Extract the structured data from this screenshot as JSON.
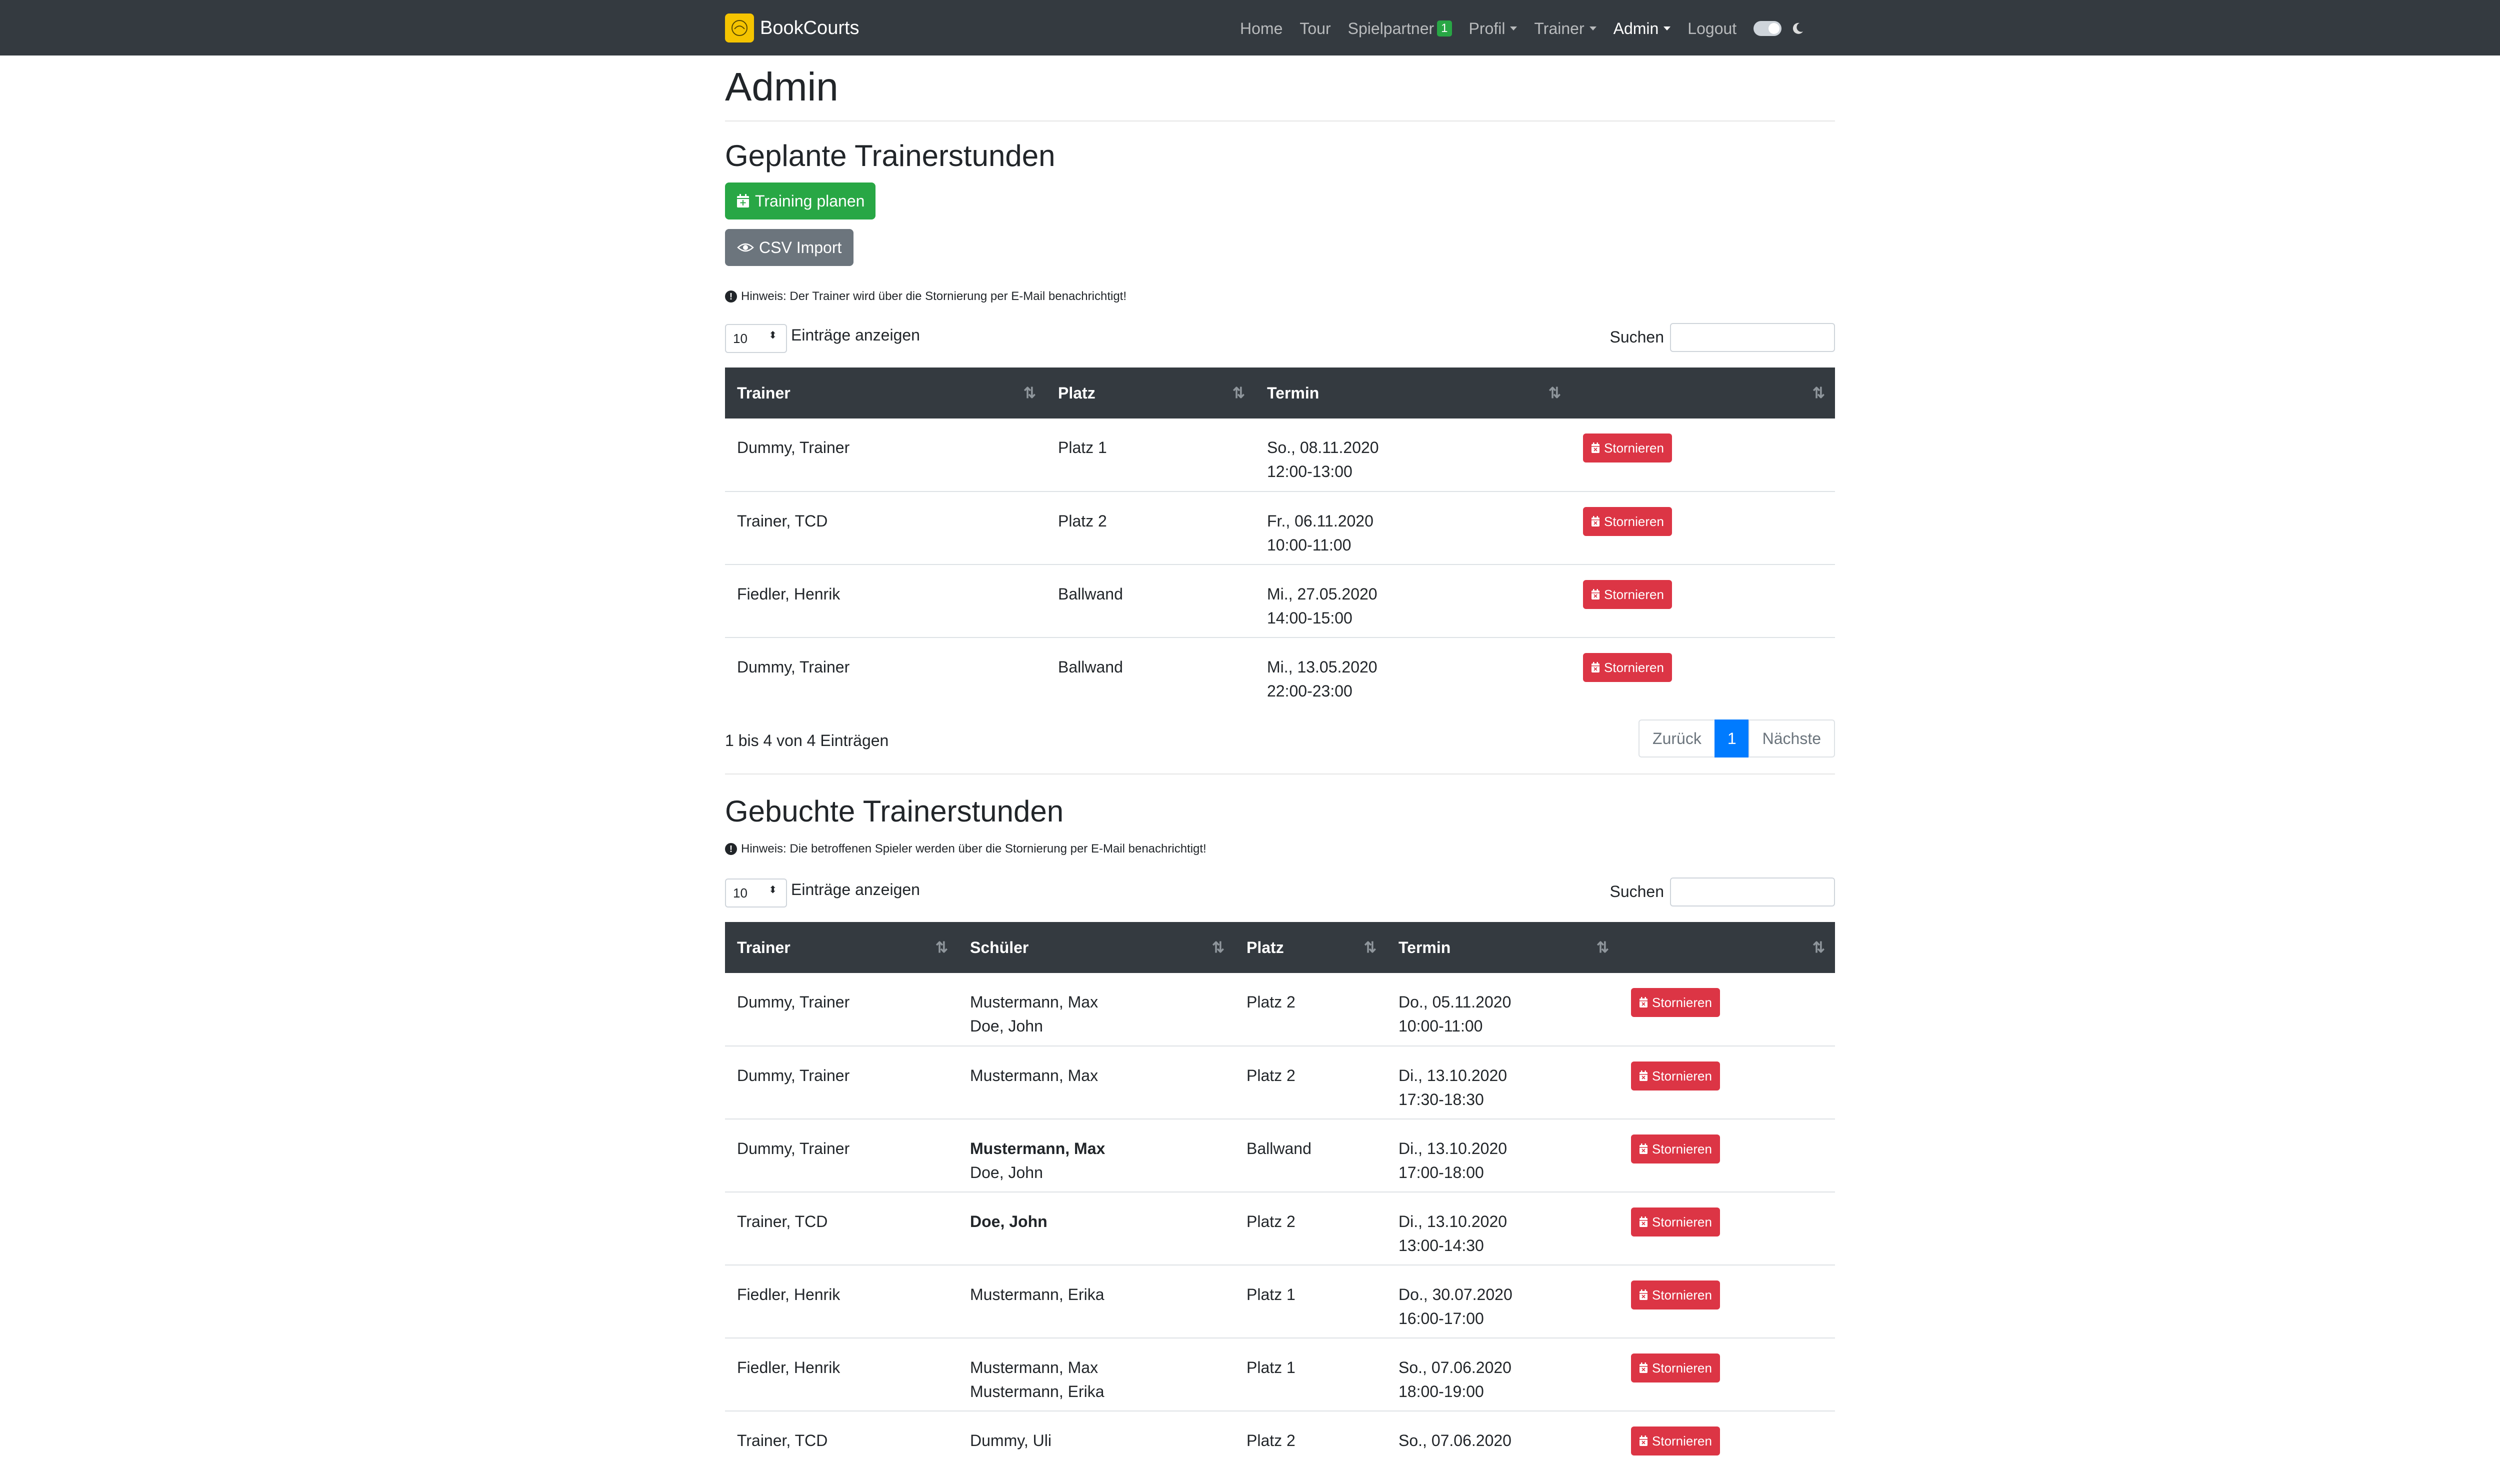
{
  "navbar": {
    "brand": "BookCourts",
    "items": [
      {
        "label": "Home"
      },
      {
        "label": "Tour"
      },
      {
        "label": "Spielpartner",
        "badge": "1"
      },
      {
        "label": "Profil"
      },
      {
        "label": "Trainer"
      },
      {
        "label": "Admin"
      },
      {
        "label": "Logout"
      }
    ]
  },
  "page": {
    "title": "Admin"
  },
  "planned": {
    "heading": "Geplante Trainerstunden",
    "plan_button": "Training planen",
    "csv_button": "CSV Import",
    "hint": "Hinweis: Der Trainer wird über die Stornierung per E-Mail benachrichtigt!",
    "length_value": "10",
    "length_label": "Einträge anzeigen",
    "search_label": "Suchen",
    "columns": [
      "Trainer",
      "Platz",
      "Termin",
      ""
    ],
    "rows": [
      {
        "trainer": "Dummy, Trainer",
        "platz": "Platz 1",
        "date": "So., 08.11.2020",
        "time": "12:00-13:00",
        "action": "Stornieren"
      },
      {
        "trainer": "Trainer, TCD",
        "platz": "Platz 2",
        "date": "Fr., 06.11.2020",
        "time": "10:00-11:00",
        "action": "Stornieren"
      },
      {
        "trainer": "Fiedler, Henrik",
        "platz": "Ballwand",
        "date": "Mi., 27.05.2020",
        "time": "14:00-15:00",
        "action": "Stornieren"
      },
      {
        "trainer": "Dummy, Trainer",
        "platz": "Ballwand",
        "date": "Mi., 13.05.2020",
        "time": "22:00-23:00",
        "action": "Stornieren"
      }
    ],
    "info": "1 bis 4 von 4 Einträgen",
    "pagination": {
      "prev": "Zurück",
      "current": "1",
      "next": "Nächste"
    }
  },
  "booked": {
    "heading": "Gebuchte Trainerstunden",
    "hint": "Hinweis: Die betroffenen Spieler werden über die Stornierung per E-Mail benachrichtigt!",
    "length_value": "10",
    "length_label": "Einträge anzeigen",
    "search_label": "Suchen",
    "columns": [
      "Trainer",
      "Schüler",
      "Platz",
      "Termin",
      ""
    ],
    "rows": [
      {
        "trainer": "Dummy, Trainer",
        "student1": "Mustermann, Max",
        "student2": "Doe, John",
        "platz": "Platz 2",
        "date": "Do., 05.11.2020",
        "time": "10:00-11:00",
        "action": "Stornieren"
      },
      {
        "trainer": "Dummy, Trainer",
        "student1": "Mustermann, Max",
        "student2": "",
        "platz": "Platz 2",
        "date": "Di., 13.10.2020",
        "time": "17:30-18:30",
        "action": "Stornieren"
      },
      {
        "trainer": "Dummy, Trainer",
        "student1": "Mustermann, Max",
        "student2": "Doe, John",
        "platz": "Ballwand",
        "date": "Di., 13.10.2020",
        "time": "17:00-18:00",
        "action": "Stornieren"
      },
      {
        "trainer": "Trainer, TCD",
        "student1": "Doe, John",
        "student2": "",
        "platz": "Platz 2",
        "date": "Di., 13.10.2020",
        "time": "13:00-14:30",
        "action": "Stornieren"
      },
      {
        "trainer": "Fiedler, Henrik",
        "student1": "Mustermann, Erika",
        "student2": "",
        "platz": "Platz 1",
        "date": "Do., 30.07.2020",
        "time": "16:00-17:00",
        "action": "Stornieren"
      },
      {
        "trainer": "Fiedler, Henrik",
        "student1": "Mustermann, Max",
        "student2": "Mustermann, Erika",
        "platz": "Platz 1",
        "date": "So., 07.06.2020",
        "time": "18:00-19:00",
        "action": "Stornieren"
      },
      {
        "trainer": "Trainer, TCD",
        "student1": "Dummy, Uli",
        "student2": "",
        "platz": "Platz 2",
        "date": "So., 07.06.2020",
        "time": "",
        "action": "Stornieren"
      }
    ]
  }
}
